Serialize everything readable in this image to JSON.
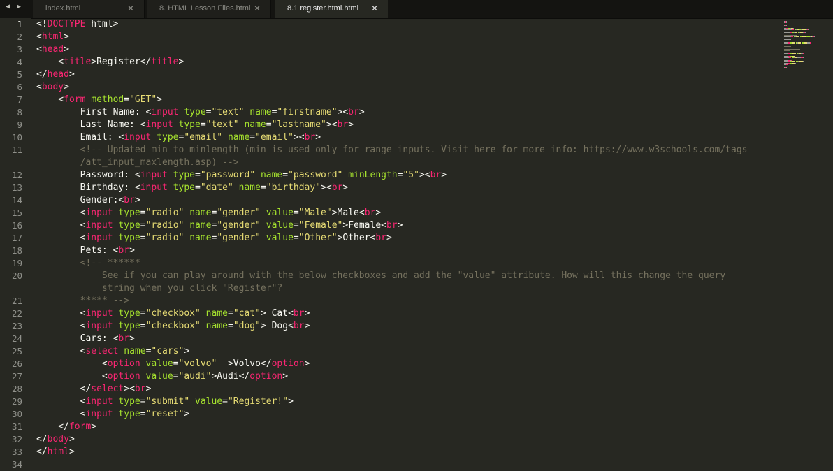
{
  "tabs": [
    {
      "label": "index.html",
      "active": false
    },
    {
      "label": "8. HTML Lesson Files.html",
      "active": false
    },
    {
      "label": "8.1 register.html.html",
      "active": true
    }
  ],
  "current_line": 1,
  "lines": [
    {
      "n": "1",
      "tokens": [
        [
          "p",
          "<!"
        ],
        [
          "t",
          "DOCTYPE"
        ],
        [
          "p",
          " html>"
        ]
      ]
    },
    {
      "n": "2",
      "tokens": [
        [
          "p",
          "<"
        ],
        [
          "t",
          "html"
        ],
        [
          "p",
          ">"
        ]
      ]
    },
    {
      "n": "3",
      "tokens": [
        [
          "p",
          "<"
        ],
        [
          "t",
          "head"
        ],
        [
          "p",
          ">"
        ]
      ]
    },
    {
      "n": "4",
      "tokens": [
        [
          "p",
          "    <"
        ],
        [
          "t",
          "title"
        ],
        [
          "p",
          ">Register</"
        ],
        [
          "t",
          "title"
        ],
        [
          "p",
          ">"
        ]
      ]
    },
    {
      "n": "5",
      "tokens": [
        [
          "p",
          "</"
        ],
        [
          "t",
          "head"
        ],
        [
          "p",
          ">"
        ]
      ]
    },
    {
      "n": "6",
      "tokens": [
        [
          "p",
          "<"
        ],
        [
          "t",
          "body"
        ],
        [
          "p",
          ">"
        ]
      ]
    },
    {
      "n": "7",
      "tokens": [
        [
          "p",
          "    <"
        ],
        [
          "t",
          "form"
        ],
        [
          "p",
          " "
        ],
        [
          "a",
          "method"
        ],
        [
          "p",
          "="
        ],
        [
          "s",
          "\"GET\""
        ],
        [
          "p",
          ">"
        ]
      ]
    },
    {
      "n": "8",
      "tokens": [
        [
          "p",
          "        First Name: <"
        ],
        [
          "t",
          "input"
        ],
        [
          "p",
          " "
        ],
        [
          "a",
          "type"
        ],
        [
          "p",
          "="
        ],
        [
          "s",
          "\"text\""
        ],
        [
          "p",
          " "
        ],
        [
          "a",
          "name"
        ],
        [
          "p",
          "="
        ],
        [
          "s",
          "\"firstname\""
        ],
        [
          "p",
          ">"
        ],
        [
          "p",
          "<"
        ],
        [
          "t",
          "br"
        ],
        [
          "p",
          ">"
        ]
      ]
    },
    {
      "n": "9",
      "tokens": [
        [
          "p",
          "        Last Name: <"
        ],
        [
          "t",
          "input"
        ],
        [
          "p",
          " "
        ],
        [
          "a",
          "type"
        ],
        [
          "p",
          "="
        ],
        [
          "s",
          "\"text\""
        ],
        [
          "p",
          " "
        ],
        [
          "a",
          "name"
        ],
        [
          "p",
          "="
        ],
        [
          "s",
          "\"lastname\""
        ],
        [
          "p",
          ">"
        ],
        [
          "p",
          "<"
        ],
        [
          "t",
          "br"
        ],
        [
          "p",
          ">"
        ]
      ]
    },
    {
      "n": "10",
      "tokens": [
        [
          "p",
          "        Email: <"
        ],
        [
          "t",
          "input"
        ],
        [
          "p",
          " "
        ],
        [
          "a",
          "type"
        ],
        [
          "p",
          "="
        ],
        [
          "s",
          "\"email\""
        ],
        [
          "p",
          " "
        ],
        [
          "a",
          "name"
        ],
        [
          "p",
          "="
        ],
        [
          "s",
          "\"email\""
        ],
        [
          "p",
          ">"
        ],
        [
          "p",
          "<"
        ],
        [
          "t",
          "br"
        ],
        [
          "p",
          ">"
        ]
      ]
    },
    {
      "n": "11",
      "tokens": [
        [
          "c",
          "        <!-- Updated min to minlength (min is used only for range inputs. Visit here for more info: https://www.w3schools.com/tags"
        ]
      ]
    },
    {
      "n": "",
      "tokens": [
        [
          "c",
          "        /att_input_maxlength.asp) -->"
        ]
      ]
    },
    {
      "n": "12",
      "tokens": [
        [
          "p",
          "        Password: <"
        ],
        [
          "t",
          "input"
        ],
        [
          "p",
          " "
        ],
        [
          "a",
          "type"
        ],
        [
          "p",
          "="
        ],
        [
          "s",
          "\"password\""
        ],
        [
          "p",
          " "
        ],
        [
          "a",
          "name"
        ],
        [
          "p",
          "="
        ],
        [
          "s",
          "\"password\""
        ],
        [
          "p",
          " "
        ],
        [
          "a",
          "minLength"
        ],
        [
          "p",
          "="
        ],
        [
          "s",
          "\"5\""
        ],
        [
          "p",
          ">"
        ],
        [
          "p",
          "<"
        ],
        [
          "t",
          "br"
        ],
        [
          "p",
          ">"
        ]
      ]
    },
    {
      "n": "13",
      "tokens": [
        [
          "p",
          "        Birthday: <"
        ],
        [
          "t",
          "input"
        ],
        [
          "p",
          " "
        ],
        [
          "a",
          "type"
        ],
        [
          "p",
          "="
        ],
        [
          "s",
          "\"date\""
        ],
        [
          "p",
          " "
        ],
        [
          "a",
          "name"
        ],
        [
          "p",
          "="
        ],
        [
          "s",
          "\"birthday\""
        ],
        [
          "p",
          ">"
        ],
        [
          "p",
          "<"
        ],
        [
          "t",
          "br"
        ],
        [
          "p",
          ">"
        ]
      ]
    },
    {
      "n": "14",
      "tokens": [
        [
          "p",
          "        Gender:<"
        ],
        [
          "t",
          "br"
        ],
        [
          "p",
          ">"
        ]
      ]
    },
    {
      "n": "15",
      "tokens": [
        [
          "p",
          "        <"
        ],
        [
          "t",
          "input"
        ],
        [
          "p",
          " "
        ],
        [
          "a",
          "type"
        ],
        [
          "p",
          "="
        ],
        [
          "s",
          "\"radio\""
        ],
        [
          "p",
          " "
        ],
        [
          "a",
          "name"
        ],
        [
          "p",
          "="
        ],
        [
          "s",
          "\"gender\""
        ],
        [
          "p",
          " "
        ],
        [
          "a",
          "value"
        ],
        [
          "p",
          "="
        ],
        [
          "s",
          "\"Male\""
        ],
        [
          "p",
          ">Male<"
        ],
        [
          "t",
          "br"
        ],
        [
          "p",
          ">"
        ]
      ]
    },
    {
      "n": "16",
      "tokens": [
        [
          "p",
          "        <"
        ],
        [
          "t",
          "input"
        ],
        [
          "p",
          " "
        ],
        [
          "a",
          "type"
        ],
        [
          "p",
          "="
        ],
        [
          "s",
          "\"radio\""
        ],
        [
          "p",
          " "
        ],
        [
          "a",
          "name"
        ],
        [
          "p",
          "="
        ],
        [
          "s",
          "\"gender\""
        ],
        [
          "p",
          " "
        ],
        [
          "a",
          "value"
        ],
        [
          "p",
          "="
        ],
        [
          "s",
          "\"Female\""
        ],
        [
          "p",
          ">Female<"
        ],
        [
          "t",
          "br"
        ],
        [
          "p",
          ">"
        ]
      ]
    },
    {
      "n": "17",
      "tokens": [
        [
          "p",
          "        <"
        ],
        [
          "t",
          "input"
        ],
        [
          "p",
          " "
        ],
        [
          "a",
          "type"
        ],
        [
          "p",
          "="
        ],
        [
          "s",
          "\"radio\""
        ],
        [
          "p",
          " "
        ],
        [
          "a",
          "name"
        ],
        [
          "p",
          "="
        ],
        [
          "s",
          "\"gender\""
        ],
        [
          "p",
          " "
        ],
        [
          "a",
          "value"
        ],
        [
          "p",
          "="
        ],
        [
          "s",
          "\"Other\""
        ],
        [
          "p",
          ">Other<"
        ],
        [
          "t",
          "br"
        ],
        [
          "p",
          ">"
        ]
      ]
    },
    {
      "n": "18",
      "tokens": [
        [
          "p",
          "        Pets: <"
        ],
        [
          "t",
          "br"
        ],
        [
          "p",
          ">"
        ]
      ]
    },
    {
      "n": "19",
      "tokens": [
        [
          "c",
          "        <!-- ******"
        ]
      ]
    },
    {
      "n": "20",
      "tokens": [
        [
          "c",
          "            See if you can play around with the below checkboxes and add the \"value\" attribute. How will this change the query"
        ]
      ]
    },
    {
      "n": "",
      "tokens": [
        [
          "c",
          "            string when you click \"Register\"?"
        ]
      ]
    },
    {
      "n": "21",
      "tokens": [
        [
          "c",
          "        ***** -->"
        ]
      ]
    },
    {
      "n": "22",
      "tokens": [
        [
          "p",
          "        <"
        ],
        [
          "t",
          "input"
        ],
        [
          "p",
          " "
        ],
        [
          "a",
          "type"
        ],
        [
          "p",
          "="
        ],
        [
          "s",
          "\"checkbox\""
        ],
        [
          "p",
          " "
        ],
        [
          "a",
          "name"
        ],
        [
          "p",
          "="
        ],
        [
          "s",
          "\"cat\""
        ],
        [
          "p",
          "> Cat<"
        ],
        [
          "t",
          "br"
        ],
        [
          "p",
          ">"
        ]
      ]
    },
    {
      "n": "23",
      "tokens": [
        [
          "p",
          "        <"
        ],
        [
          "t",
          "input"
        ],
        [
          "p",
          " "
        ],
        [
          "a",
          "type"
        ],
        [
          "p",
          "="
        ],
        [
          "s",
          "\"checkbox\""
        ],
        [
          "p",
          " "
        ],
        [
          "a",
          "name"
        ],
        [
          "p",
          "="
        ],
        [
          "s",
          "\"dog\""
        ],
        [
          "p",
          "> Dog<"
        ],
        [
          "t",
          "br"
        ],
        [
          "p",
          ">"
        ]
      ]
    },
    {
      "n": "24",
      "tokens": [
        [
          "p",
          "        Cars: <"
        ],
        [
          "t",
          "br"
        ],
        [
          "p",
          ">"
        ]
      ]
    },
    {
      "n": "25",
      "tokens": [
        [
          "p",
          "        <"
        ],
        [
          "t",
          "select"
        ],
        [
          "p",
          " "
        ],
        [
          "a",
          "name"
        ],
        [
          "p",
          "="
        ],
        [
          "s",
          "\"cars\""
        ],
        [
          "p",
          ">"
        ]
      ]
    },
    {
      "n": "26",
      "tokens": [
        [
          "p",
          "            <"
        ],
        [
          "t",
          "option"
        ],
        [
          "p",
          " "
        ],
        [
          "a",
          "value"
        ],
        [
          "p",
          "="
        ],
        [
          "s",
          "\"volvo\""
        ],
        [
          "p",
          "  >Volvo</"
        ],
        [
          "t",
          "option"
        ],
        [
          "p",
          ">"
        ]
      ]
    },
    {
      "n": "27",
      "tokens": [
        [
          "p",
          "            <"
        ],
        [
          "t",
          "option"
        ],
        [
          "p",
          " "
        ],
        [
          "a",
          "value"
        ],
        [
          "p",
          "="
        ],
        [
          "s",
          "\"audi\""
        ],
        [
          "p",
          ">Audi</"
        ],
        [
          "t",
          "option"
        ],
        [
          "p",
          ">"
        ]
      ]
    },
    {
      "n": "28",
      "tokens": [
        [
          "p",
          "        </"
        ],
        [
          "t",
          "select"
        ],
        [
          "p",
          ">"
        ],
        [
          "p",
          "<"
        ],
        [
          "t",
          "br"
        ],
        [
          "p",
          ">"
        ]
      ]
    },
    {
      "n": "29",
      "tokens": [
        [
          "p",
          "        <"
        ],
        [
          "t",
          "input"
        ],
        [
          "p",
          " "
        ],
        [
          "a",
          "type"
        ],
        [
          "p",
          "="
        ],
        [
          "s",
          "\"submit\""
        ],
        [
          "p",
          " "
        ],
        [
          "a",
          "value"
        ],
        [
          "p",
          "="
        ],
        [
          "s",
          "\"Register!\""
        ],
        [
          "p",
          ">"
        ]
      ]
    },
    {
      "n": "30",
      "tokens": [
        [
          "p",
          "        <"
        ],
        [
          "t",
          "input"
        ],
        [
          "p",
          " "
        ],
        [
          "a",
          "type"
        ],
        [
          "p",
          "="
        ],
        [
          "s",
          "\"reset\""
        ],
        [
          "p",
          ">"
        ]
      ]
    },
    {
      "n": "31",
      "tokens": [
        [
          "p",
          "    </"
        ],
        [
          "t",
          "form"
        ],
        [
          "p",
          ">"
        ]
      ]
    },
    {
      "n": "32",
      "tokens": [
        [
          "p",
          "</"
        ],
        [
          "t",
          "body"
        ],
        [
          "p",
          ">"
        ]
      ]
    },
    {
      "n": "33",
      "tokens": [
        [
          "p",
          "</"
        ],
        [
          "t",
          "html"
        ],
        [
          "p",
          ">"
        ]
      ]
    },
    {
      "n": "34",
      "tokens": [
        [
          "p",
          ""
        ]
      ]
    }
  ],
  "colors": {
    "background": "#272822",
    "tag": "#f92672",
    "attribute": "#a6e22e",
    "string": "#e6db74",
    "comment": "#75715e",
    "text": "#f8f8f2"
  }
}
